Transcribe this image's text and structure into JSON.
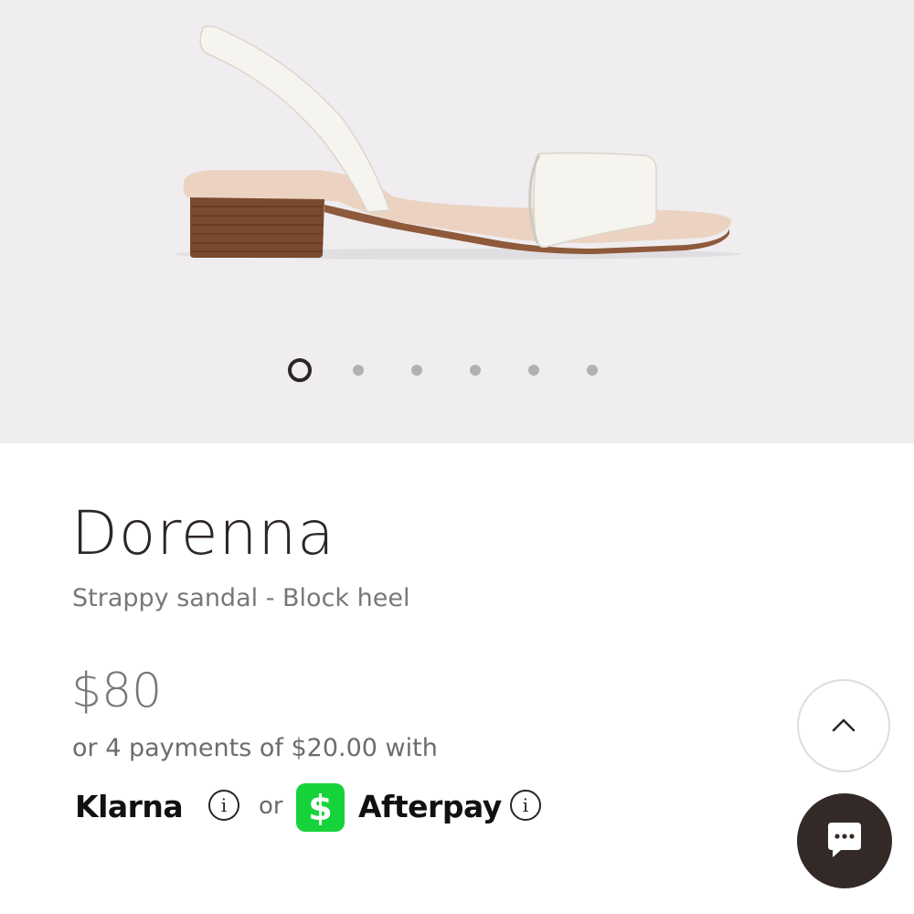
{
  "product": {
    "name": "Dorenna",
    "description": "Strappy sandal - Block heel",
    "price": "$80",
    "installments": "or 4 payments of $20.00 with"
  },
  "gallery": {
    "image_count": 6,
    "active_index": 0
  },
  "payment": {
    "klarna_label": "Klarna",
    "or_label": "or",
    "cash_icon_glyph": "$",
    "afterpay_label": "Afterpay",
    "info_glyph": "i",
    "cash_app_color": "#16d33a"
  },
  "icons": {
    "scroll_top": "chevron-up-icon",
    "chat": "chat-bubble-icon"
  }
}
